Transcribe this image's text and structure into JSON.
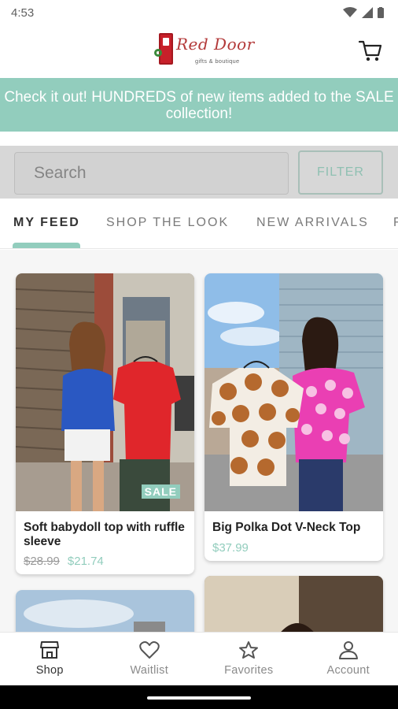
{
  "status_bar": {
    "time": "4:53"
  },
  "header": {
    "logo_title": "Red Door",
    "logo_subtitle": "gifts & boutique"
  },
  "banner": {
    "text": "Check it out! HUNDREDS of new items added to the SALE collection!"
  },
  "search": {
    "placeholder": "Search",
    "filter_label": "FILTER"
  },
  "tabs": [
    {
      "label": "MY FEED",
      "active": true
    },
    {
      "label": "SHOP THE LOOK",
      "active": false
    },
    {
      "label": "NEW ARRIVALS",
      "active": false
    },
    {
      "label": "F",
      "active": false
    }
  ],
  "products": [
    {
      "title": "Soft babydoll top with ruffle sleeve",
      "price_old": "$28.99",
      "price_new": "$21.74",
      "badge": "SALE"
    },
    {
      "title": "Big Polka Dot V-Neck Top",
      "price_new": "$37.99"
    }
  ],
  "bottom_nav": [
    {
      "label": "Shop",
      "icon": "storefront-icon",
      "active": true
    },
    {
      "label": "Waitlist",
      "icon": "heart-icon",
      "active": false
    },
    {
      "label": "Favorites",
      "icon": "star-icon",
      "active": false
    },
    {
      "label": "Account",
      "icon": "person-icon",
      "active": false
    }
  ],
  "colors": {
    "accent": "#92cdbd",
    "brand_red": "#c8202a"
  }
}
